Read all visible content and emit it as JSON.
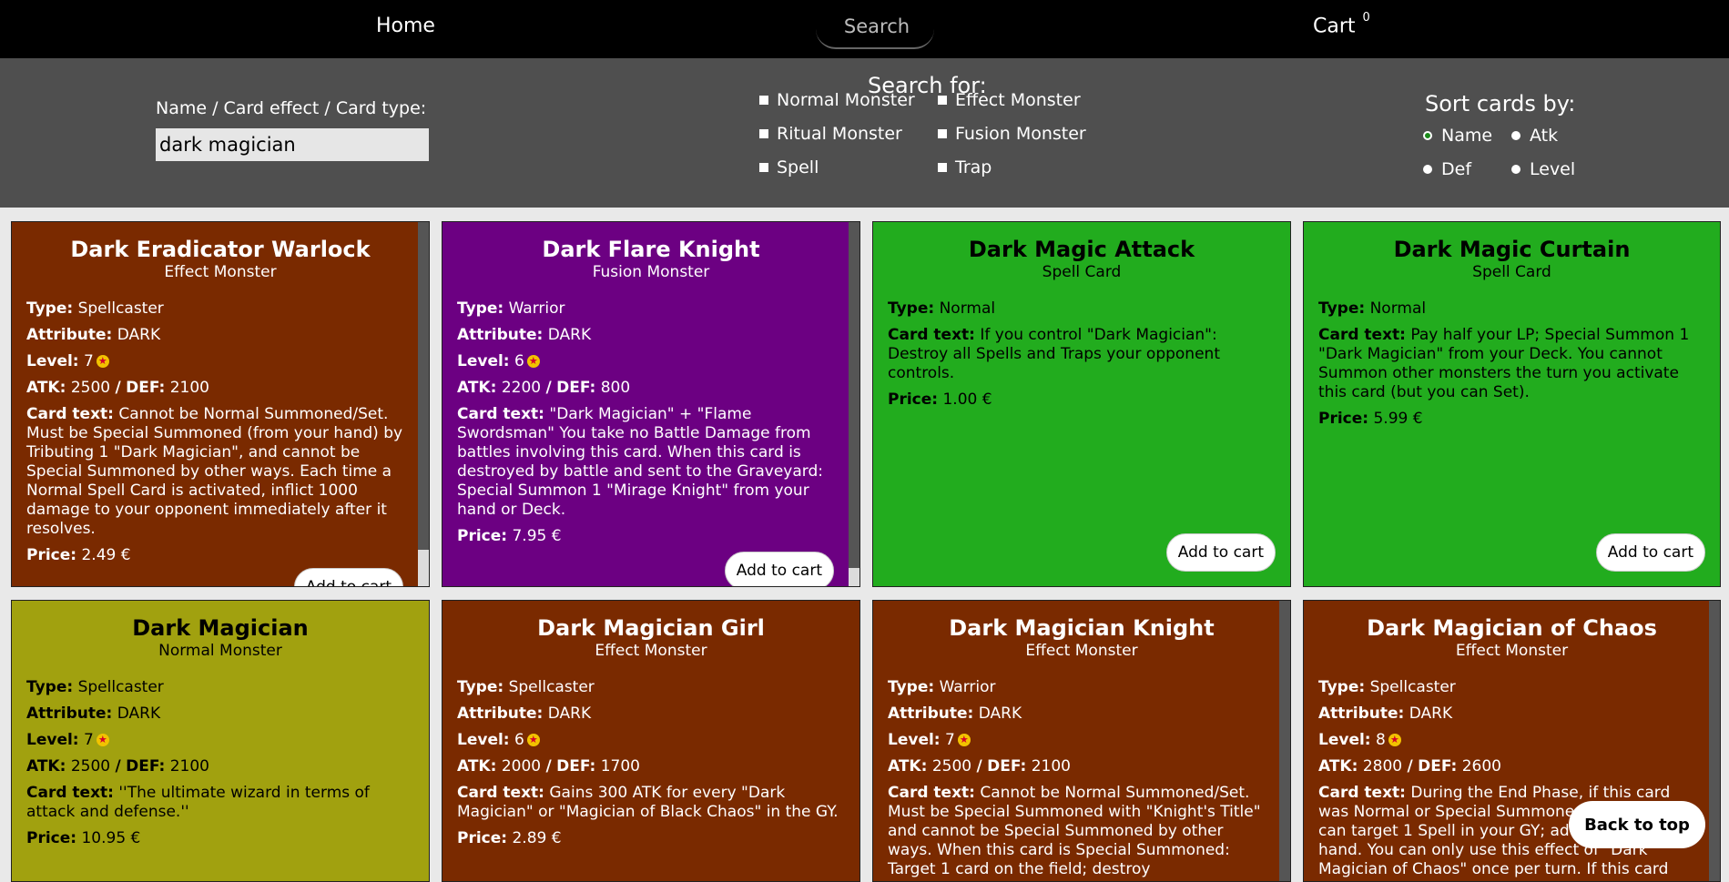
{
  "nav": {
    "home": "Home",
    "search_placeholder": "Search",
    "cart": "Cart",
    "cart_count": "0"
  },
  "filters": {
    "name_label": "Name / Card effect / Card type:",
    "name_value": "dark magician",
    "search_for_title": "Search for:",
    "types": [
      "Normal Monster",
      "Effect Monster",
      "Ritual Monster",
      "Fusion Monster",
      "Spell",
      "Trap"
    ],
    "sort_title": "Sort cards by:",
    "sort_options": [
      "Name",
      "Atk",
      "Def",
      "Level"
    ],
    "sort_selected": "Name"
  },
  "cards": [
    {
      "name": "Dark Eradicator Warlock",
      "kind": "Effect Monster",
      "type": "Spellcaster",
      "attribute": "DARK",
      "level": "7",
      "atk": "2500",
      "def": "2100",
      "text": "Cannot be Normal Summoned/Set. Must be Special Summoned (from your hand) by Tributing 1 \"Dark Magician\", and cannot be Special Summoned by other ways. Each time a Normal Spell Card is activated, inflict 1000 damage to your opponent immediately after it resolves.",
      "price": "2.49 €",
      "button": "Add to cart"
    },
    {
      "name": "Dark Flare Knight",
      "kind": "Fusion Monster",
      "type": "Warrior",
      "attribute": "DARK",
      "level": "6",
      "atk": "2200",
      "def": "800",
      "text": "\"Dark Magician\" + \"Flame Swordsman\" You take no Battle Damage from battles involving this card. When this card is destroyed by battle and sent to the Graveyard: Special Summon 1 \"Mirage Knight\" from your hand or Deck.",
      "price": "7.95 €",
      "button": "Add to cart"
    },
    {
      "name": "Dark Magic Attack",
      "kind": "Spell Card",
      "type": "Normal",
      "text": "If you control \"Dark Magician\": Destroy all Spells and Traps your opponent controls.",
      "price": "1.00 €",
      "button": "Add to cart"
    },
    {
      "name": "Dark Magic Curtain",
      "kind": "Spell Card",
      "type": "Normal",
      "text": "Pay half your LP; Special Summon 1 \"Dark Magician\" from your Deck. You cannot Summon other monsters the turn you activate this card (but you can Set).",
      "price": "5.99 €",
      "button": "Add to cart"
    },
    {
      "name": "Dark Magician",
      "kind": "Normal Monster",
      "type": "Spellcaster",
      "attribute": "DARK",
      "level": "7",
      "atk": "2500",
      "def": "2100",
      "text": "''The ultimate wizard in terms of attack and defense.''",
      "price": "10.95 €"
    },
    {
      "name": "Dark Magician Girl",
      "kind": "Effect Monster",
      "type": "Spellcaster",
      "attribute": "DARK",
      "level": "6",
      "atk": "2000",
      "def": "1700",
      "text": "Gains 300 ATK for every \"Dark Magician\" or \"Magician of Black Chaos\" in the GY.",
      "price": "2.89 €"
    },
    {
      "name": "Dark Magician Knight",
      "kind": "Effect Monster",
      "type": "Warrior",
      "attribute": "DARK",
      "level": "7",
      "atk": "2500",
      "def": "2100",
      "text": "Cannot be Normal Summoned/Set. Must be Special Summoned with \"Knight's Title\" and cannot be Special Summoned by other ways. When this card is Special Summoned: Target 1 card on the field; destroy"
    },
    {
      "name": "Dark Magician of Chaos",
      "kind": "Effect Monster",
      "type": "Spellcaster",
      "attribute": "DARK",
      "level": "8",
      "atk": "2800",
      "def": "2600",
      "text": "During the End Phase, if this card was Normal or Special Summoned this turn: You can target 1 Spell in your GY; add it to your hand. You can only use this effect of \"Dark Magician of Chaos\" once per turn. If this card"
    }
  ],
  "labels": {
    "type": "Type:",
    "attribute": "Attribute:",
    "level": "Level:",
    "atk": "ATK:",
    "def": "DEF:",
    "card_text": "Card text:",
    "price": "Price:"
  },
  "back_to_top": "Back to top",
  "colors": {
    "effect": "#7a2a00",
    "fusion": "#6c0082",
    "spell": "#22ac1e",
    "normal": "#a1a10f"
  }
}
